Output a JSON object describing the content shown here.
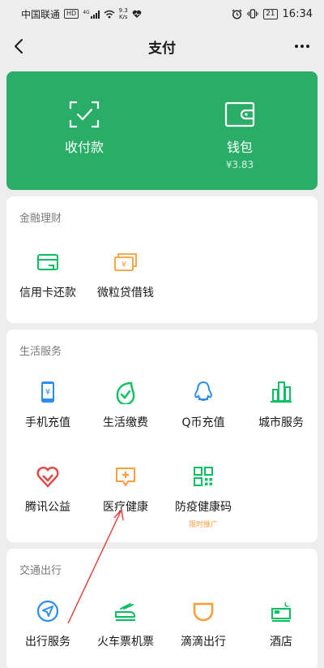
{
  "status_bar": {
    "carrier": "中国联通",
    "hd_badge": "HD",
    "network": "4G",
    "speed_value": "9.3",
    "speed_unit": "K/s",
    "battery": "21",
    "time": "16:34"
  },
  "nav": {
    "title": "支付"
  },
  "pay_card": {
    "collect_label": "收付款",
    "wallet_label": "钱包",
    "wallet_balance": "¥3.83"
  },
  "finance": {
    "title": "金融理财",
    "items": [
      {
        "label": "信用卡还款",
        "icon": "credit-card-icon"
      },
      {
        "label": "微粒贷借钱",
        "icon": "loan-icon"
      }
    ]
  },
  "life": {
    "title": "生活服务",
    "items": [
      {
        "label": "手机充值",
        "icon": "phone-recharge-icon"
      },
      {
        "label": "生活缴费",
        "icon": "utility-icon"
      },
      {
        "label": "Q币充值",
        "icon": "qq-coin-icon"
      },
      {
        "label": "城市服务",
        "icon": "city-icon"
      },
      {
        "label": "腾讯公益",
        "icon": "charity-icon"
      },
      {
        "label": "医疗健康",
        "icon": "medical-icon"
      },
      {
        "label": "防疫健康码",
        "icon": "qr-code-icon",
        "sub": "限时推广"
      }
    ]
  },
  "transport": {
    "title": "交通出行",
    "items": [
      {
        "label": "出行服务",
        "icon": "navigation-icon"
      },
      {
        "label": "火车票机票",
        "icon": "train-icon"
      },
      {
        "label": "滴滴出行",
        "icon": "didi-icon"
      },
      {
        "label": "酒店",
        "icon": "hotel-icon"
      }
    ]
  },
  "colors": {
    "brand_green": "#2aae67",
    "icon_green": "#07c160",
    "icon_blue": "#2a8ef0",
    "icon_orange": "#fa9d3b",
    "icon_red": "#e64340",
    "annotation_red": "#e53935"
  }
}
